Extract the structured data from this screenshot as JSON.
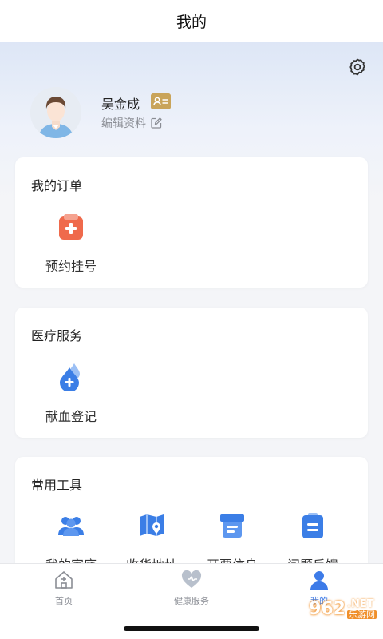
{
  "header": {
    "title": "我的"
  },
  "profile": {
    "name": "吴金成",
    "edit_label": "编辑资料",
    "badge_color": "#c9a45a"
  },
  "orders": {
    "title": "我的订单",
    "items": [
      {
        "label": "预约挂号",
        "icon": "appointment-clipboard-icon"
      }
    ]
  },
  "medical": {
    "title": "医疗服务",
    "items": [
      {
        "label": "献血登记",
        "icon": "blood-donation-icon"
      }
    ]
  },
  "tools": {
    "title": "常用工具",
    "items": [
      {
        "label": "我的家庭",
        "icon": "family-icon"
      },
      {
        "label": "收货地址",
        "icon": "map-address-icon"
      },
      {
        "label": "开票信息",
        "icon": "invoice-icon"
      },
      {
        "label": "问题反馈",
        "icon": "feedback-icon"
      }
    ]
  },
  "tabbar": {
    "items": [
      {
        "label": "首页",
        "icon": "home-icon"
      },
      {
        "label": "健康服务",
        "icon": "heart-icon"
      },
      {
        "label": "我的",
        "icon": "user-icon"
      }
    ],
    "active_index": 2
  },
  "watermark": {
    "number": "962",
    "net": ".NET",
    "site": "乐游网"
  },
  "colors": {
    "accent": "#3d7be8",
    "icon_blue": "#3b7ee6",
    "appointment_red": "#ef6a4c",
    "gold": "#c9a45a"
  }
}
